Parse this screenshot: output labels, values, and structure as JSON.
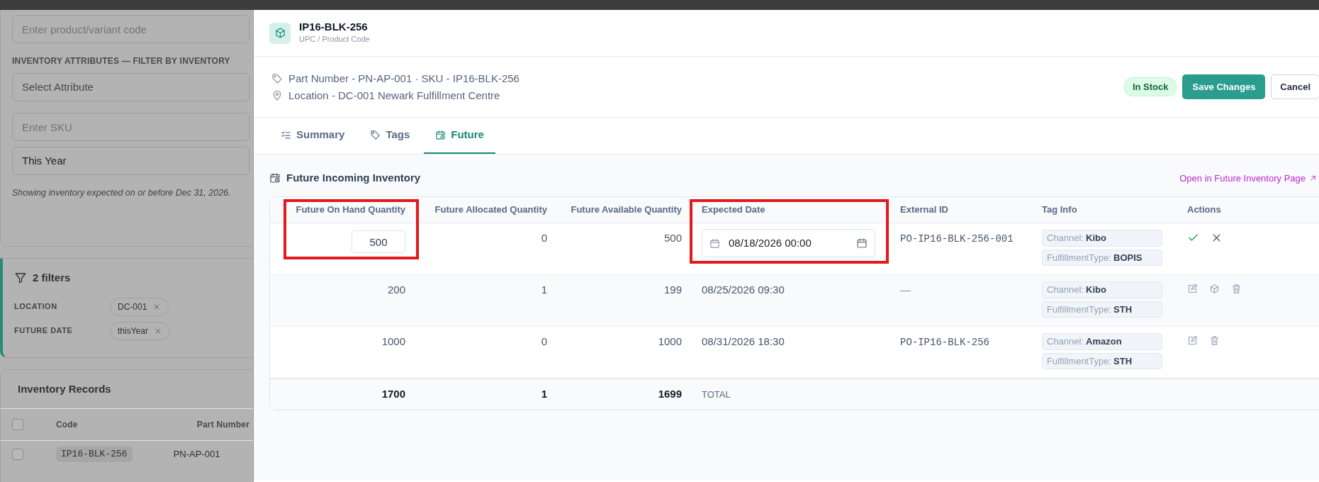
{
  "background": {
    "filters_form": {
      "code_field": {
        "placeholder": "Enter product/variant code"
      },
      "attributes_label": "INVENTORY ATTRIBUTES — FILTER BY INVENTORY",
      "attribute_select": {
        "placeholder": "Select Attribute"
      },
      "sku_field": {
        "placeholder": "Enter SKU"
      },
      "date_select": {
        "value": "This Year"
      },
      "note": "Showing inventory expected on or before Dec 31, 2026."
    },
    "active_filters": {
      "title": "2 filters",
      "filters": [
        {
          "label": "LOCATION",
          "value": "DC-001"
        },
        {
          "label": "FUTURE DATE",
          "value": "thisYear"
        }
      ]
    },
    "records": {
      "title": "Inventory Records",
      "select_all": {
        "checked": false
      },
      "columns": [
        "Code",
        "Part Number"
      ],
      "rows": [
        {
          "checked": false,
          "code": "IP16-BLK-256",
          "part_number": "PN-AP-001"
        }
      ]
    }
  },
  "drawer": {
    "title": "IP16-BLK-256",
    "subtitle": "UPC / Product Code",
    "part_line": "Part Number - PN-AP-001 · SKU - IP16-BLK-256",
    "location_line": "Location - DC-001 Newark Fulfillment Centre",
    "status_badge": "In Stock",
    "buttons": [
      {
        "label": "Save Changes",
        "kind": "primary"
      },
      {
        "label": "Cancel",
        "kind": "secondary"
      }
    ],
    "tabs": [
      {
        "label": "Summary",
        "selected": false
      },
      {
        "label": "Tags",
        "selected": false
      },
      {
        "label": "Future",
        "selected": true
      }
    ],
    "section_title": "Future Incoming Inventory",
    "open_link": "Open in Future Inventory Page",
    "table": {
      "columns": [
        {
          "label": "Future On Hand Quantity",
          "highlighted": true
        },
        {
          "label": "Future Allocated Quantity"
        },
        {
          "label": "Future Available Quantity"
        },
        {
          "label": "Expected Date",
          "highlighted": true
        },
        {
          "label": "External ID"
        },
        {
          "label": "Tag Info"
        },
        {
          "label": "Actions"
        }
      ],
      "rows": [
        {
          "editing": true,
          "on_hand": "500",
          "allocated": "0",
          "available": "500",
          "expected_date": "08/18/2026 00:00",
          "external_id": "PO-IP16-BLK-256-001",
          "tags": [
            {
              "key": "Channel:",
              "value": "Kibo"
            },
            {
              "key": "FulfillmentType:",
              "value": "BOPIS"
            }
          ],
          "actions": [
            {
              "kind": "confirm"
            },
            {
              "kind": "cancel"
            }
          ]
        },
        {
          "editing": false,
          "on_hand": "200",
          "allocated": "1",
          "available": "199",
          "expected_date": "08/25/2026 09:30",
          "external_id": "—",
          "tags": [
            {
              "key": "Channel:",
              "value": "Kibo"
            },
            {
              "key": "FulfillmentType:",
              "value": "STH"
            }
          ],
          "actions": [
            {
              "kind": "edit"
            },
            {
              "kind": "cube"
            },
            {
              "kind": "delete"
            }
          ]
        },
        {
          "editing": false,
          "on_hand": "1000",
          "allocated": "0",
          "available": "1000",
          "expected_date": "08/31/2026 18:30",
          "external_id": "PO-IP16-BLK-256",
          "tags": [
            {
              "key": "Channel:",
              "value": "Amazon"
            },
            {
              "key": "FulfillmentType:",
              "value": "STH"
            }
          ],
          "actions": [
            {
              "kind": "edit"
            },
            {
              "kind": "delete"
            }
          ]
        }
      ],
      "total": {
        "on_hand": "1700",
        "allocated": "1",
        "available": "1699",
        "label": "TOTAL"
      }
    }
  }
}
